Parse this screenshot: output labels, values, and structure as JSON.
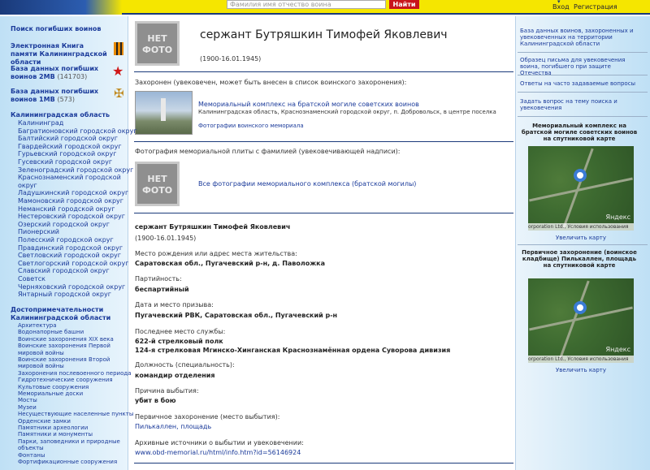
{
  "header": {
    "search_placeholder": "Фамилия имя отчество воина",
    "search_button": "Найти",
    "login": "Вход",
    "register": "Регистрация"
  },
  "left": {
    "search_title": "Поиск погибших воинов",
    "ebook": "Электронная Книга памяти Калининградской области",
    "db2": "База данных погибших воинов 2МВ",
    "db2_count": "(141703)",
    "db1": "База данных погибших воинов 1МВ",
    "db1_count": "(573)",
    "region_title": "Калининградская область",
    "region_items": [
      "Калининград",
      "Багратионовский городской округ",
      "Балтийский городской округ",
      "Гвардейский городской округ",
      "Гурьевский городской округ",
      "Гусевский городской округ",
      "Зеленоградский городской округ",
      "Краснознаменский городской",
      "округ",
      "Ладушкинский городской округ",
      "Мамоновский городской округ",
      "Неманский городской округ",
      "Нестеровский городской округ",
      "Озерский городской округ",
      "Пионерский",
      "Полесский городской округ",
      "Правдинский городской округ",
      "Светловский городской округ",
      "Светлогорский городской округ",
      "Славский городской округ",
      "Советск",
      "Черняховский городской округ",
      "Янтарный городской округ"
    ],
    "sights_title": "Достопримечательности Калининградской области",
    "sights_items": [
      "Архитектура",
      "Водонапорные башни",
      "Воинские захоронения XIX века",
      "Воинские захоронения Первой",
      "мировой войны",
      "Воинские захоронения Второй",
      "мировой войны",
      "Захоронения послевоенного периода",
      "Гидротехнические сооружения",
      "Культовые сооружения",
      "Мемориальные доски",
      "Мосты",
      "Музеи",
      "Несуществующие населенные пункты",
      "Орденские замки",
      "Памятники археологии",
      "Памятники и монументы",
      "Парки, заповедники и природные",
      "объекты",
      "Фонтаны",
      "Фортификационные сооружения"
    ]
  },
  "main": {
    "no_photo": "НЕТ ФОТО",
    "title": "сержант Бутряшкин Тимофей Яковлевич",
    "dates": "(1900-16.01.1945)",
    "buried_label": "Захоронен (увековечен, может быть внесен в список воинского захоронения):",
    "memorial_name": "Мемориальный комплекс на братской могиле советских воинов",
    "memorial_address": "Калининградская область, Краснознаменский городской округ, п. Добровольск, в центре поселка",
    "memorial_photos": "Фотографии воинского мемориала",
    "plate_label": "Фотография мемориальной плиты с фамилией (увековечивающей надписи):",
    "plate_link": "Все фотографии мемориального комплекса (братской могилы)",
    "info_name": "сержант Бутряшкин Тимофей Яковлевич",
    "info_dates": "(1900-16.01.1945)",
    "birth_label": "Место рождения или адрес места жительства:",
    "birth_value": "Саратовская обл., Пугачевский р-н, д. Паволожка",
    "party_label": "Партийность:",
    "party_value": "беспартийный",
    "draft_label": "Дата и место призыва:",
    "draft_value": "Пугачевский РВК, Саратовская обл., Пугачевский р-н",
    "service_label": "Последнее место службы:",
    "service_value1": "622-й стрелковый полк",
    "service_value2": "124-я стрелковая Мгинско-Хинганская Краснознамённая ордена Суворова дивизия",
    "position_label": "Должность (специальность):",
    "position_value": "командир отделения",
    "cause_label": "Причина выбытия:",
    "cause_value": "убит в бою",
    "primary_label": "Первичное захоронение (место выбытия):",
    "primary_value": "Пилькаллен, площадь",
    "archive_label": "Архивные источники о выбытии и увековечении:",
    "archive_link": "www.obd-memorial.ru/html/info.htm?id=56146924"
  },
  "right": {
    "link1": "База данных воинов, захороненных и увековеченных на территории Калининградской области",
    "link2": "Образец письма для увековечения воина, погибшего при защите Отечества",
    "link3": "Ответы на часто задаваемые вопросы",
    "link4": "Задать вопрос на тему поиска и увековечения",
    "map1_title": "Мемориальный комплекс на братской могиле советских воинов на спутниковой карте",
    "map_footer": "orporation Ltd.,  Условия использования",
    "map_brand": "Яндекс",
    "enlarge": "Увеличить карту",
    "map2_title": "Первичное захоронение (воинское кладбище) Пилькаллен, площадь на спутниковой карте"
  },
  "colors": {
    "header_yellow": "#f5e600",
    "link_blue": "#1a3a9a",
    "button_red": "#c8141c",
    "divider": "#1a3a7a"
  }
}
